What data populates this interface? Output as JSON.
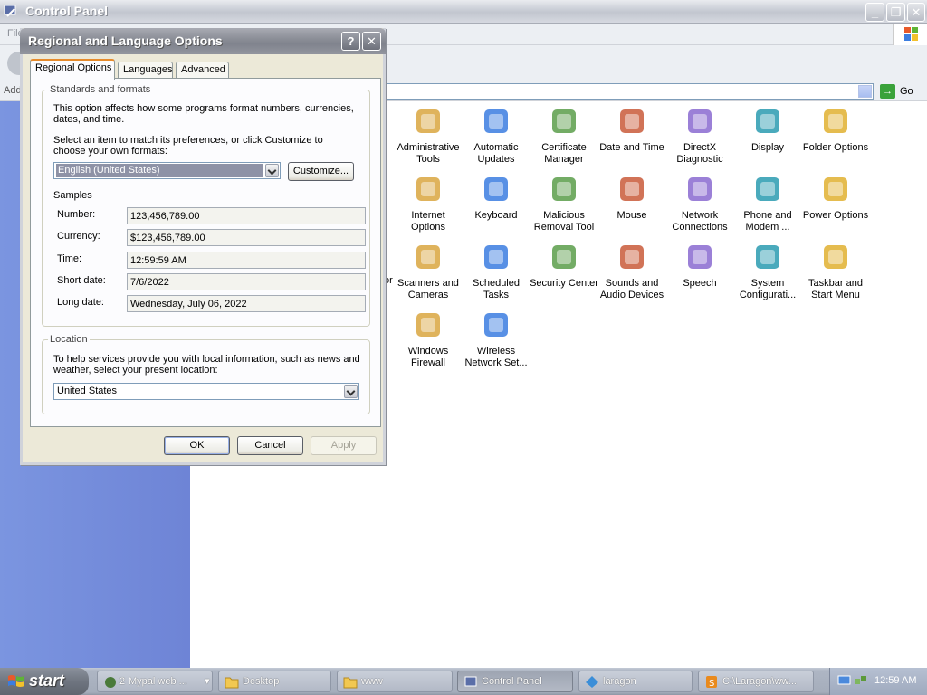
{
  "control_panel": {
    "title": "Control Panel",
    "menu_partial": "File",
    "address_label": "Address",
    "go_label": "Go",
    "items": [
      {
        "label": "Administrative Tools",
        "icon": "administrative-tools-icon"
      },
      {
        "label": "Automatic Updates",
        "icon": "automatic-updates-icon"
      },
      {
        "label": "Certificate Manager",
        "icon": "certificate-manager-icon"
      },
      {
        "label": "Date and Time",
        "icon": "date-time-icon"
      },
      {
        "label": "DirectX Diagnostic",
        "icon": "directx-icon"
      },
      {
        "label": "Display",
        "icon": "display-icon"
      },
      {
        "label": "Folder Options",
        "icon": "folder-options-icon"
      },
      {
        "label": "Internet Options",
        "icon": "internet-options-icon"
      },
      {
        "label": "Keyboard",
        "icon": "keyboard-icon"
      },
      {
        "label": "Malicious Removal Tool",
        "icon": "malicious-removal-icon"
      },
      {
        "label": "Mouse",
        "icon": "mouse-icon"
      },
      {
        "label": "Network Connections",
        "icon": "network-connections-icon"
      },
      {
        "label": "Phone and Modem ...",
        "icon": "phone-modem-icon"
      },
      {
        "label": "Power Options",
        "icon": "power-options-icon"
      },
      {
        "label": "Scanners and Cameras",
        "icon": "scanners-cameras-icon"
      },
      {
        "label": "Scheduled Tasks",
        "icon": "scheduled-tasks-icon"
      },
      {
        "label": "Security Center",
        "icon": "security-center-icon"
      },
      {
        "label": "Sounds and Audio Devices",
        "icon": "sounds-audio-icon"
      },
      {
        "label": "Speech",
        "icon": "speech-icon"
      },
      {
        "label": "System Configurati...",
        "icon": "system-config-icon"
      },
      {
        "label": "Taskbar and Start Menu",
        "icon": "taskbar-start-icon"
      },
      {
        "label": "Windows Firewall",
        "icon": "firewall-icon"
      },
      {
        "label": "Wireless Network Set...",
        "icon": "wireless-network-icon"
      }
    ],
    "partial_left_label": "or"
  },
  "dialog": {
    "title": "Regional and Language Options",
    "help_glyph": "?",
    "close_glyph": "✕",
    "tabs": [
      "Regional Options",
      "Languages",
      "Advanced"
    ],
    "standards": {
      "group_title": "Standards and formats",
      "desc": "This option affects how some programs format numbers, currencies, dates, and time.",
      "select_hint": "Select an item to match its preferences, or click Customize to choose your own formats:",
      "locale_value": "English (United States)",
      "customize_label": "Customize...",
      "samples_label": "Samples",
      "samples": [
        {
          "label": "Number:",
          "value": "123,456,789.00"
        },
        {
          "label": "Currency:",
          "value": "$123,456,789.00"
        },
        {
          "label": "Time:",
          "value": "12:59:59 AM"
        },
        {
          "label": "Short date:",
          "value": "7/6/2022"
        },
        {
          "label": "Long date:",
          "value": "Wednesday, July 06, 2022"
        }
      ]
    },
    "location": {
      "group_title": "Location",
      "desc": "To help services provide you with local information, such as news and weather, select your present location:",
      "value": "United States"
    },
    "buttons": {
      "ok": "OK",
      "cancel": "Cancel",
      "apply": "Apply"
    }
  },
  "taskbar": {
    "start_label": "start",
    "tasks": [
      {
        "label": "Mypal web ...",
        "prefix": "2"
      },
      {
        "label": "Desktop"
      },
      {
        "label": "www"
      },
      {
        "label": "Control Panel"
      },
      {
        "label": "laragon"
      },
      {
        "label": "C:\\Laragon\\ww..."
      }
    ],
    "clock": "12:59 AM"
  }
}
